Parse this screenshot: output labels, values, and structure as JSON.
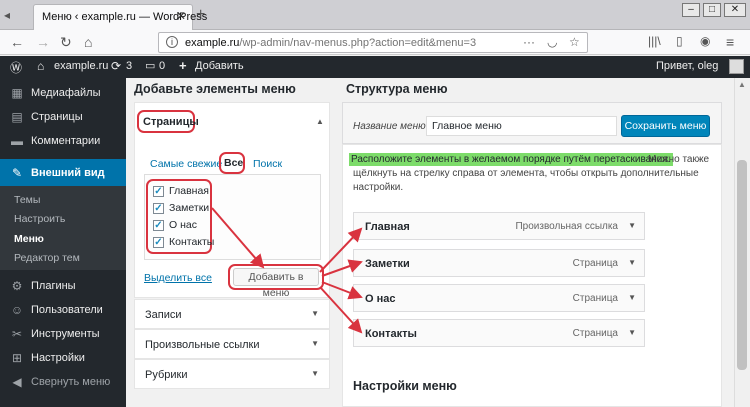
{
  "browser": {
    "tab_title": "Меню ‹ example.ru — WordPress",
    "url_host": "example.ru",
    "url_path": "/wp-admin/nav-menus.php?action=edit&menu=3"
  },
  "adminbar": {
    "site": "example.ru",
    "updates": "3",
    "comments": "0",
    "add": "Добавить",
    "greeting": "Привет, oleg"
  },
  "sidebar": {
    "items": [
      {
        "label": "Медиафайлы",
        "icon": "media-icon"
      },
      {
        "label": "Страницы",
        "icon": "pages-icon"
      },
      {
        "label": "Комментарии",
        "icon": "comments-icon"
      },
      {
        "label": "Внешний вид",
        "icon": "appearance-icon"
      },
      {
        "label": "Плагины",
        "icon": "plugins-icon"
      },
      {
        "label": "Пользователи",
        "icon": "users-icon"
      },
      {
        "label": "Инструменты",
        "icon": "tools-icon"
      },
      {
        "label": "Настройки",
        "icon": "settings-icon"
      },
      {
        "label": "Свернуть меню",
        "icon": "collapse-icon"
      }
    ],
    "submenu": [
      "Темы",
      "Настроить",
      "Меню",
      "Редактор тем"
    ]
  },
  "left_panel": {
    "heading": "Добавьте элементы меню",
    "pages_title": "Страницы",
    "tabs": [
      "Самые свежие",
      "Все",
      "Поиск"
    ],
    "pages": [
      "Главная",
      "Заметки",
      "О нас",
      "Контакты"
    ],
    "select_all": "Выделить все",
    "add_button": "Добавить в меню",
    "sections": [
      "Записи",
      "Произвольные ссылки",
      "Рубрики"
    ]
  },
  "right_panel": {
    "heading": "Структура меню",
    "name_label": "Название меню",
    "name_value": "Главное меню",
    "save_button": "Сохранить меню",
    "hint_highlight": "Расположите элементы в желаемом порядке путём перетаскивания.",
    "hint_line1_rest": "Можно также",
    "hint_line2": "щёлкнуть на стрелку справа от элемента, чтобы открыть дополнительные",
    "hint_line3": "настройки.",
    "items": [
      {
        "label": "Главная",
        "type": "Произвольная ссылка"
      },
      {
        "label": "Заметки",
        "type": "Страница"
      },
      {
        "label": "О нас",
        "type": "Страница"
      },
      {
        "label": "Контакты",
        "type": "Страница"
      }
    ],
    "settings_heading": "Настройки меню"
  },
  "colors": {
    "accent": "#0073aa",
    "annotation": "#d9333f",
    "highlight": "#7ddc6a"
  }
}
